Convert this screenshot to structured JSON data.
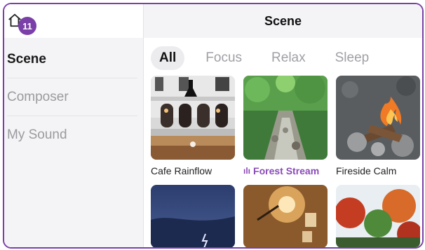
{
  "badge": {
    "count": "11"
  },
  "sidebar": {
    "items": [
      {
        "label": "Scene",
        "active": true
      },
      {
        "label": "Composer",
        "active": false
      },
      {
        "label": "My Sound",
        "active": false
      }
    ]
  },
  "header": {
    "title": "Scene"
  },
  "tabs": [
    {
      "label": "All",
      "active": true
    },
    {
      "label": "Focus",
      "active": false
    },
    {
      "label": "Relax",
      "active": false
    },
    {
      "label": "Sleep",
      "active": false
    }
  ],
  "scenes": [
    {
      "name": "Cafe Rainflow",
      "playing": false
    },
    {
      "name": "Forest Stream",
      "playing": true,
      "playing_icon": "waveform-icon"
    },
    {
      "name": "Fireside Calm",
      "playing": false
    }
  ],
  "colors": {
    "accent": "#7a3fa8",
    "sidebar_bg": "#f4f4f6"
  }
}
